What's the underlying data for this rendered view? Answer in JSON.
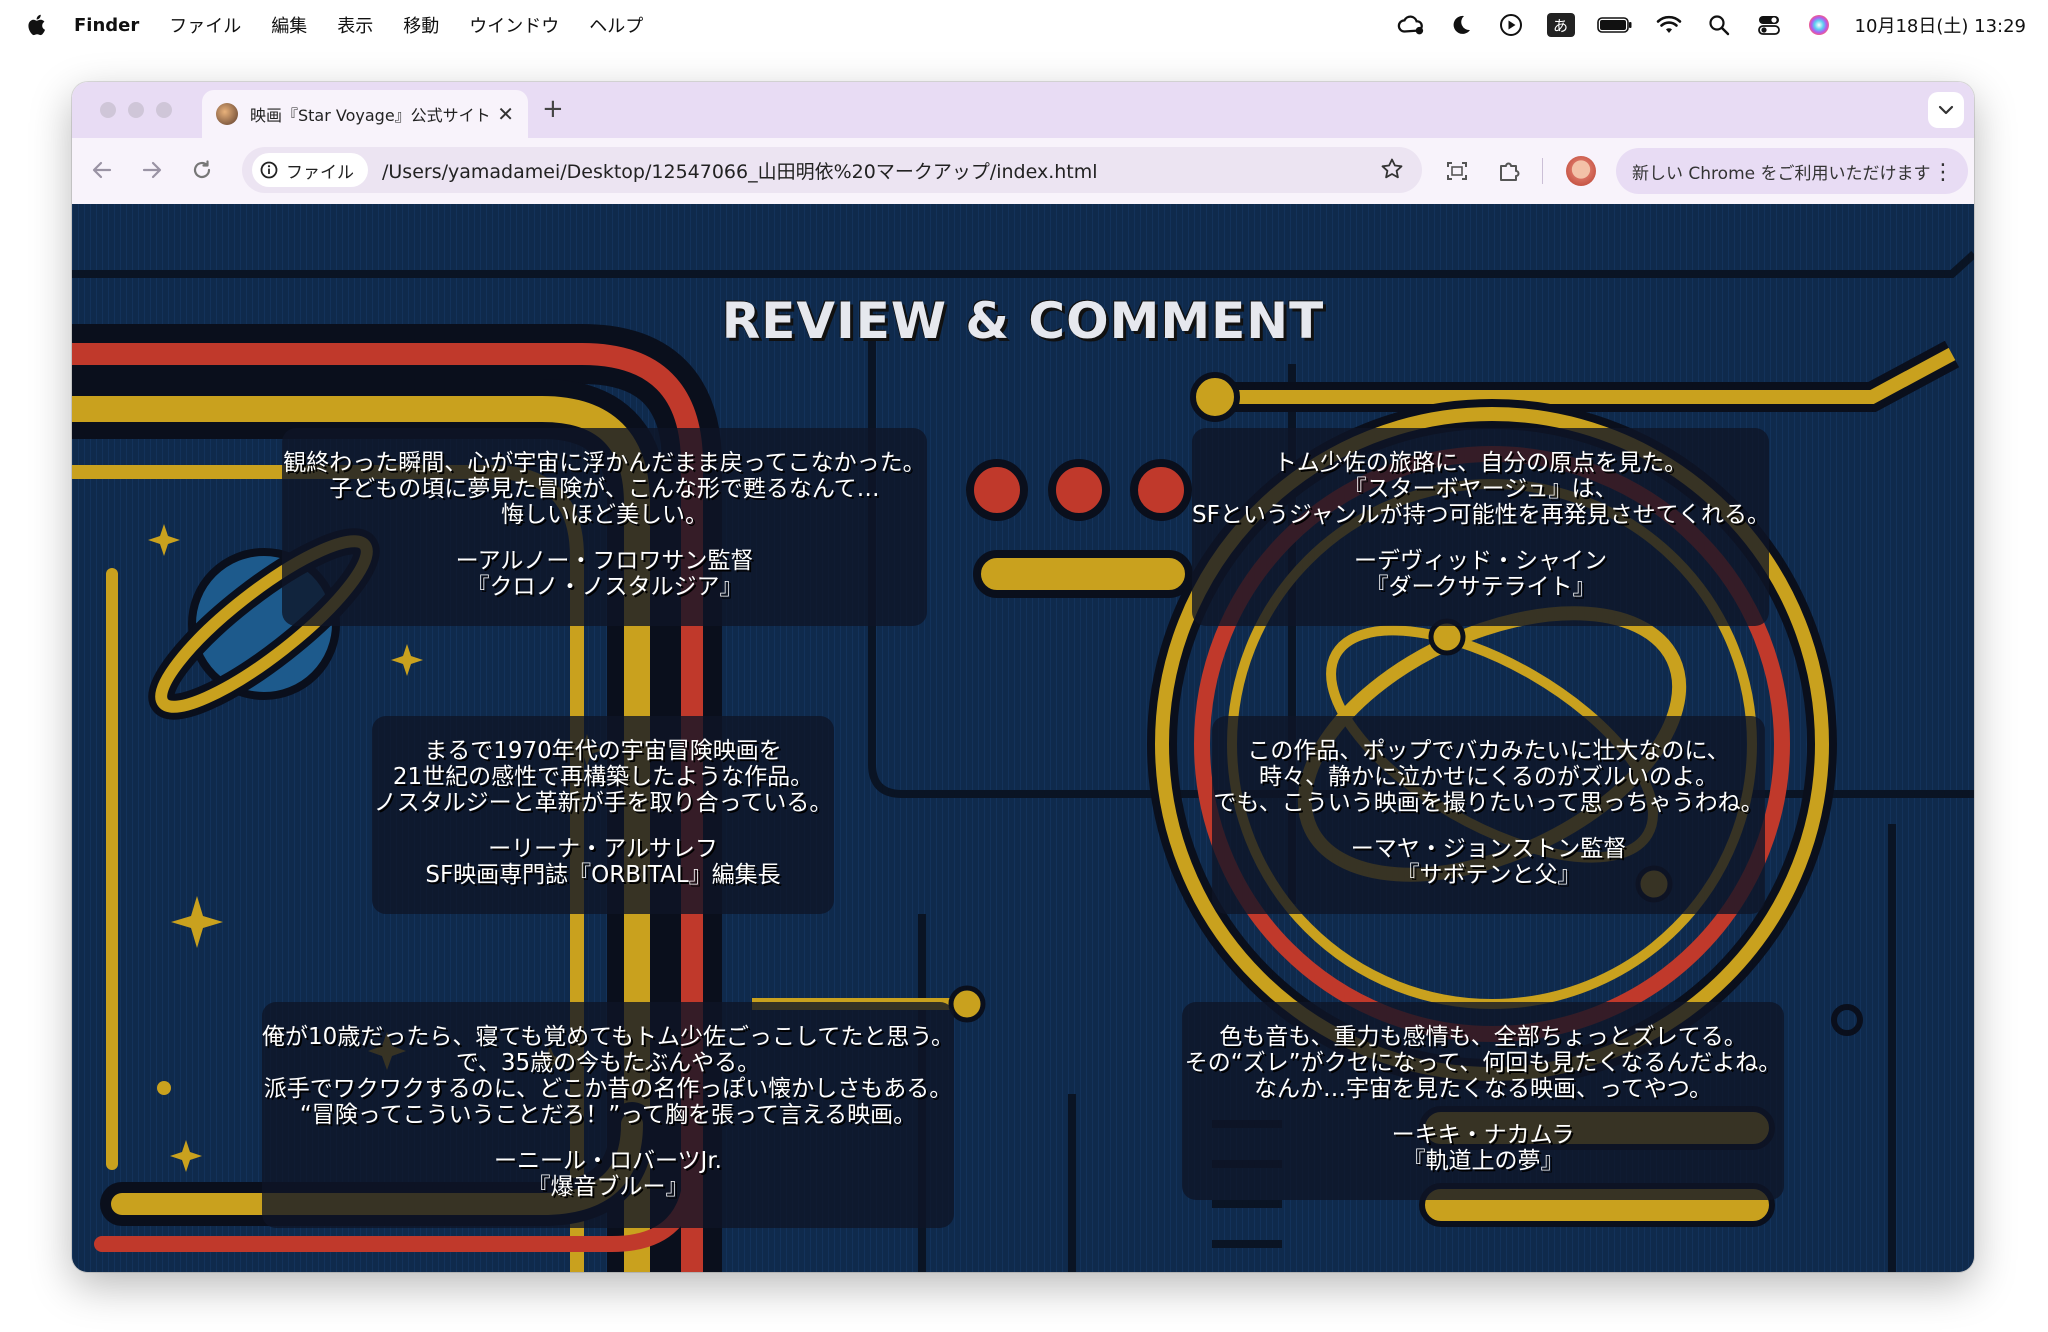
{
  "menubar": {
    "app": "Finder",
    "items": [
      "ファイル",
      "編集",
      "表示",
      "移動",
      "ウインドウ",
      "ヘルプ"
    ],
    "ime": "あ",
    "clock": "10月18日(土) 13:29",
    "icons": [
      "creative-cloud-icon",
      "do-not-disturb-icon",
      "play-icon",
      "input-method-icon",
      "battery-icon",
      "wifi-icon",
      "spotlight-icon",
      "control-center-icon",
      "siri-icon"
    ]
  },
  "browser": {
    "tab_title": "映画『Star Voyage』公式サイト",
    "chip_label": "ファイル",
    "url": "/Users/yamadamei/Desktop/12547066_山田明依%20マークアップ/index.html",
    "chrome_prompt": "新しい Chrome をご利用いただけます"
  },
  "page": {
    "heading": "REVIEW & COMMENT",
    "colors": {
      "background": "#0f2a4c",
      "gold": "#c9a11e",
      "red": "#c0392b",
      "card": "rgba(14,20,38,0.78)"
    },
    "reviews": [
      {
        "quote": [
          "観終わった瞬間、心が宇宙に浮かんだまま戻ってこなかった。",
          "子どもの頃に夢見た冒険が、こんな形で甦るなんて…",
          "悔しいほど美しい。"
        ],
        "name": "ーアルノー・フロワサン監督",
        "work": "『クロノ・ノスタルジア』"
      },
      {
        "quote": [
          "トム少佐の旅路に、自分の原点を見た。",
          "『スターボヤージュ』は、",
          "SFというジャンルが持つ可能性を再発見させてくれる。"
        ],
        "name": "ーデヴィッド・シャイン",
        "work": "『ダークサテライト』"
      },
      {
        "quote": [
          "まるで1970年代の宇宙冒険映画を",
          "21世紀の感性で再構築したような作品。",
          "ノスタルジーと革新が手を取り合っている。"
        ],
        "name": "ーリーナ・アルサレフ",
        "work": "SF映画専門誌『ORBITAL』編集長"
      },
      {
        "quote": [
          "この作品、ポップでバカみたいに壮大なのに、",
          "時々、静かに泣かせにくるのがズルいのよ。",
          "でも、こういう映画を撮りたいって思っちゃうわね。"
        ],
        "name": "ーマヤ・ジョンストン監督",
        "work": "『サボテンと父』"
      },
      {
        "quote": [
          "俺が10歳だったら、寝ても覚めてもトム少佐ごっこしてたと思う。",
          "で、35歳の今もたぶんやる。",
          "派手でワクワクするのに、どこか昔の名作っぽい懐かしさもある。",
          "“冒険ってこういうことだろ！”って胸を張って言える映画。"
        ],
        "name": "ーニール・ロバーツJr.",
        "work": "『爆音ブルー』"
      },
      {
        "quote": [
          "色も音も、重力も感情も、全部ちょっとズレてる。",
          "その“ズレ”がクセになって、何回も見たくなるんだよね。",
          "なんか…宇宙を見たくなる映画、ってやつ。"
        ],
        "name": "ーキキ・ナカムラ",
        "work": "『軌道上の夢』"
      }
    ]
  }
}
